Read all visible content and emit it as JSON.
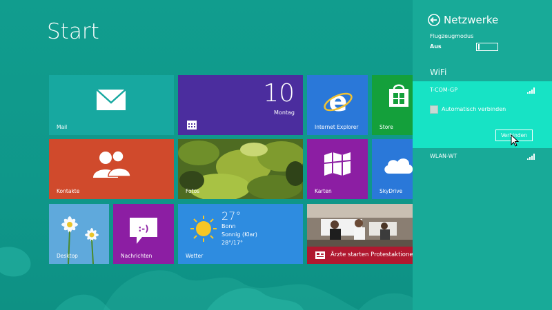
{
  "start": {
    "title": "Start"
  },
  "tiles": {
    "mail": {
      "label": "Mail",
      "color": "#17a8a0"
    },
    "calendar": {
      "day_number": "10",
      "day_name": "Montag",
      "color": "#4b2d9e"
    },
    "ie": {
      "label": "Internet Explorer",
      "color": "#2a78d9"
    },
    "store": {
      "label": "Store",
      "color": "#14a03b"
    },
    "contacts": {
      "label": "Kontakte",
      "color": "#d04a2c"
    },
    "photos": {
      "label": "Fotos"
    },
    "maps": {
      "label": "Karten",
      "color": "#8c1ea3"
    },
    "skydrive": {
      "label": "SkyDrive",
      "color": "#2a78d9"
    },
    "desktop": {
      "label": "Desktop"
    },
    "messaging": {
      "label": "Nachrichten",
      "color": "#8c1ea3"
    },
    "weather": {
      "label": "Wetter",
      "temperature": "27°",
      "city": "Bonn",
      "condition": "Sonnig (Klar)",
      "range": "28°/17°",
      "color": "#2e8ce0"
    },
    "news": {
      "headline": "Ärzte starten Protestaktionen",
      "color": "#b0182f"
    }
  },
  "network_panel": {
    "title": "Netzwerke",
    "airplane_mode_label": "Flugzeugmodus",
    "airplane_mode_value": "Aus",
    "wifi_section_title": "WiFi",
    "networks": [
      {
        "name": "T-COM-GP",
        "auto_connect_label": "Automatisch verbinden",
        "auto_connect_checked": false,
        "connect_button": "Verbinden"
      },
      {
        "name": "WLAN-WT"
      }
    ],
    "panel_color": "#18aa98",
    "selected_color": "#17e3c5"
  }
}
